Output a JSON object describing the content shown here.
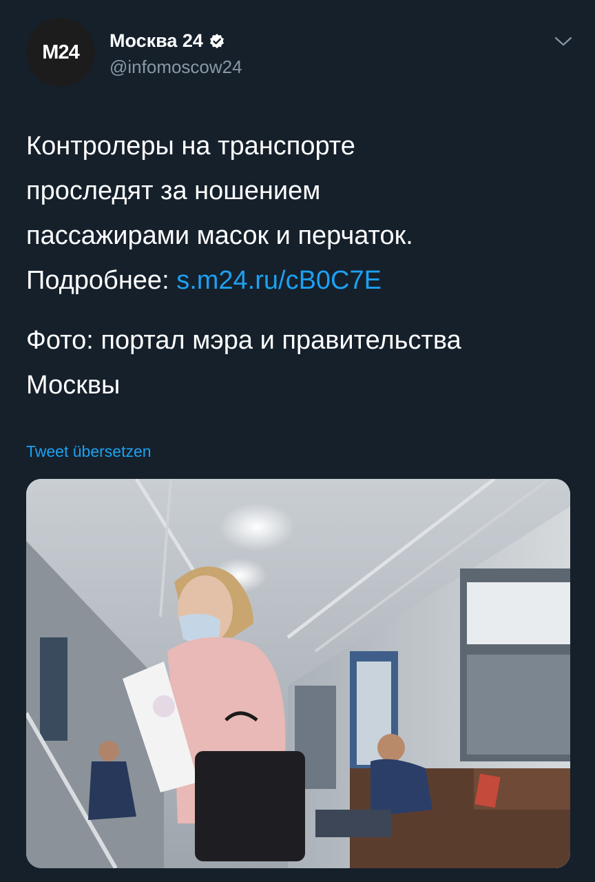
{
  "account": {
    "avatar_text": "M24",
    "display_name": "Москва 24",
    "handle": "@infomoscow24",
    "verified_icon": "verified-badge-icon",
    "menu_icon": "chevron-down-icon"
  },
  "tweet": {
    "text_line1": "Контролеры на транспорте",
    "text_line2": "проследят за ношением",
    "text_line3": "пассажирами масок и перчаток.",
    "more_label": "Подробнее: ",
    "link": "s.m24.ru/cB0C7E",
    "photo_credit_line1": "Фото: портал мэра и правительства",
    "photo_credit_line2": "Москвы",
    "translate_label": "Tweet übersetzen"
  },
  "media": {
    "description_icon": "photo-metro-car-masked-woman"
  },
  "colors": {
    "background": "#15202b",
    "accent": "#1da1f2",
    "secondary_text": "#8899a6"
  }
}
